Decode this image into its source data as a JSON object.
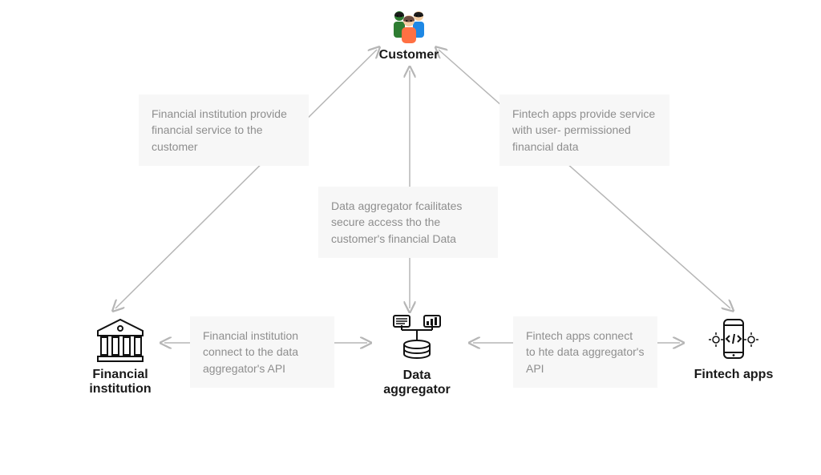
{
  "nodes": {
    "customer": "Customer",
    "financial_institution": "Financial\ninstitution",
    "data_aggregator": "Data\naggregator",
    "fintech_apps": "Fintech apps"
  },
  "boxes": {
    "top_left": "Financial institution provide financial service to the customer",
    "top_right": "Fintech apps provide service with user- permissioned financial data",
    "center": "Data aggregator fcailitates secure access tho the customer's financial Data",
    "bottom_left": "Financial institution connect to the data aggregator's API",
    "bottom_right": "Fintech apps connect to hte data aggregator's API"
  }
}
